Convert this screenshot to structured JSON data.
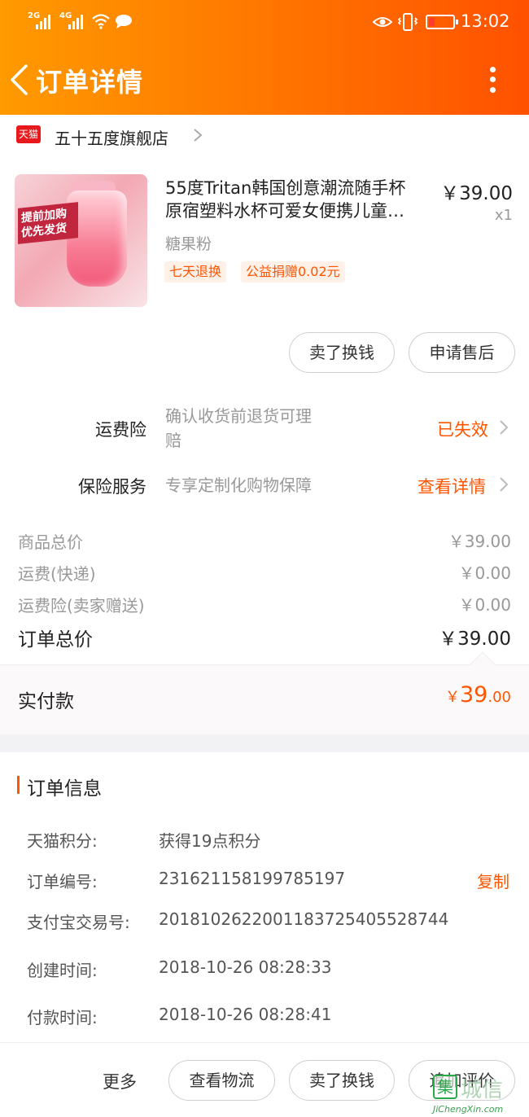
{
  "status_bar": {
    "signal1": "2G",
    "signal2": "4G",
    "time": "13:02"
  },
  "header": {
    "title": "订单详情"
  },
  "shop": {
    "logo_text": "天猫",
    "name": "五十五度旗舰店"
  },
  "product": {
    "promo_line1": "提前加购",
    "promo_line2": "优先发货",
    "title_line1": "55度Tritan韩国创意潮流随手杯",
    "title_line2": "原宿塑料水杯可爱女便携儿童…",
    "price": "￥39.00",
    "quantity": "x1",
    "variant": "糖果粉",
    "tags": [
      "七天退换",
      "公益捐赠0.02元"
    ]
  },
  "item_actions": {
    "resell": "卖了换钱",
    "after_sale": "申请售后"
  },
  "insurance": {
    "shipping_label": "运费险",
    "shipping_desc_line1": "确认收货前退货可理",
    "shipping_desc_line2": "赔",
    "shipping_status": "已失效",
    "service_label": "保险服务",
    "service_desc": "专享定制化购物保障",
    "service_status": "查看详情"
  },
  "fees": [
    {
      "label": "商品总价",
      "value": "￥39.00"
    },
    {
      "label": "运费(快递)",
      "value": "￥0.00"
    },
    {
      "label": "运费险(卖家赠送)",
      "value": "￥0.00"
    }
  ],
  "total": {
    "label": "订单总价",
    "value": "￥39.00"
  },
  "paid": {
    "label": "实付款",
    "currency": "￥",
    "integer": "39",
    "decimal": ".00"
  },
  "order_info": {
    "title": "订单信息",
    "points_label": "天猫积分:",
    "points_value": "获得19点积分",
    "order_no_label": "订单编号:",
    "order_no_value": "231621158199785197",
    "copy": "复制",
    "alipay_label": "支付宝交易号:",
    "alipay_value": "2018102622001183725405528744",
    "created_label": "创建时间:",
    "created_value": "2018-10-26 08:28:33",
    "paid_label": "付款时间:",
    "paid_value": "2018-10-26 08:28:41"
  },
  "footer": {
    "more": "更多",
    "logistics": "查看物流",
    "resell": "卖了换钱",
    "review": "追加评价"
  },
  "watermark": {
    "logo": "集",
    "text": "城信",
    "url": "JiChengXin.com"
  },
  "colors": {
    "accent": "#ff5500",
    "header_start": "#ff9a00",
    "header_end": "#ff5100"
  }
}
